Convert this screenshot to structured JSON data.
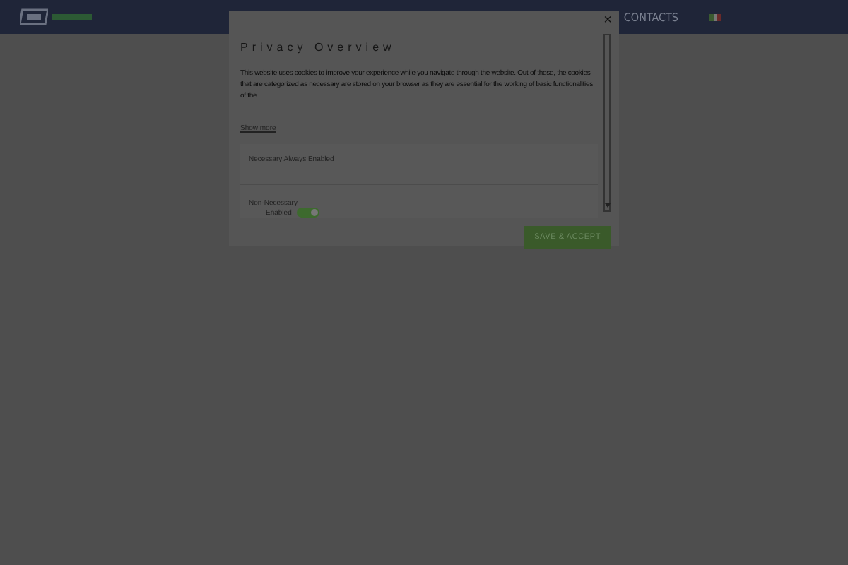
{
  "header": {
    "nav": [
      {
        "label": "CONTACTS"
      }
    ]
  },
  "modal": {
    "close": "×",
    "title": "Privacy Overview",
    "text": "This website uses cookies to improve your experience while you navigate through the website. Out of these, the cookies that are categorized as necessary are stored on your browser as they are essential for the working of basic functionalities of the",
    "ellipsis": "...",
    "show_more": "Show more",
    "sections": [
      {
        "kind": "always",
        "label": "Necessary Always Enabled"
      },
      {
        "kind": "toggle",
        "label": "Non-Necessary",
        "state_label": "Enabled",
        "on": true
      }
    ],
    "button": "SAVE & ACCEPT"
  }
}
